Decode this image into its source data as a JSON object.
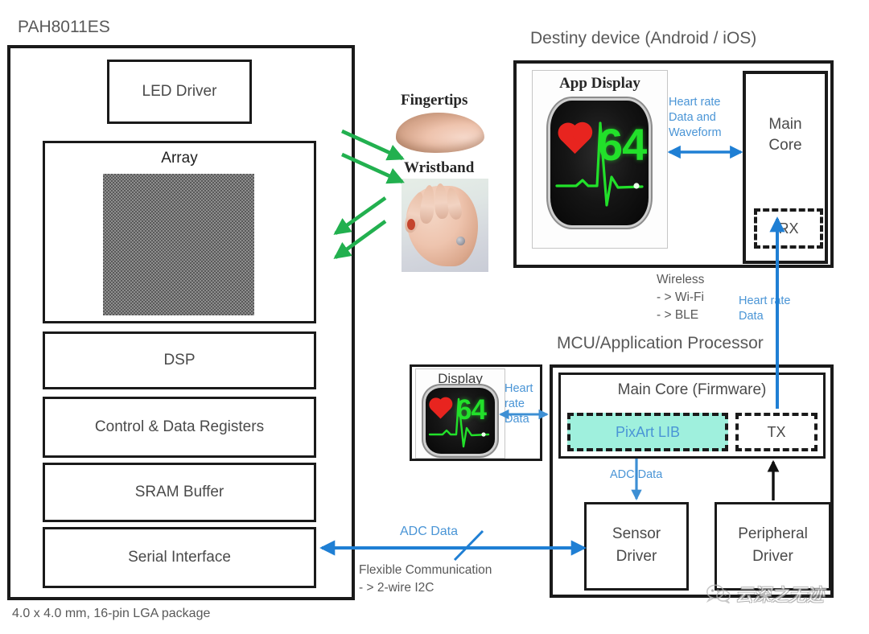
{
  "diagram": {
    "type": "block-diagram",
    "title_left": "PAH8011ES",
    "footnote_left": "4.0 x 4.0 mm, 16-pin LGA package",
    "title_destiny": "Destiny device (Android / iOS)",
    "title_mcu": "MCU/Application Processor"
  },
  "sensor_chip": {
    "label": "PAH8011ES",
    "blocks": [
      {
        "label": "LED Driver"
      },
      {
        "label": "Array"
      },
      {
        "label": "DSP"
      },
      {
        "label": "Control & Data Registers"
      },
      {
        "label": "SRAM Buffer"
      },
      {
        "label": "Serial Interface"
      }
    ],
    "package_note": "4.0 x 4.0 mm, 16-pin LGA package"
  },
  "sensing_targets": [
    {
      "label": "Fingertips",
      "icon": "fingertip-photo"
    },
    {
      "label": "Wristband",
      "icon": "wrist-photo"
    }
  ],
  "destiny_device": {
    "title": "Destiny device (Android / iOS)",
    "display_panel": {
      "label": "App Display",
      "heart_rate": "64",
      "icon": "heart-icon"
    },
    "link_label": "Heart rate\nData and\nWaveform",
    "link_lines": [
      "Heart rate",
      "Data and",
      "Waveform"
    ],
    "main_core": {
      "label_lines": [
        "Main",
        "Core"
      ]
    },
    "rx_block": {
      "label": "RX"
    }
  },
  "wireless": {
    "heading": "Wireless",
    "options": [
      "- > Wi-Fi",
      "- > BLE"
    ],
    "uplink_lines": [
      "Heart rate",
      "Data"
    ]
  },
  "mcu": {
    "title": "MCU/Application Processor",
    "display_panel": {
      "label": "Display",
      "heart_rate": "64",
      "icon": "heart-icon"
    },
    "link_lines": [
      "Heart",
      "rate",
      "Data"
    ],
    "main_core": {
      "label": "Main Core (Firmware)"
    },
    "pixart_lib": {
      "label": "PixArt  LIB"
    },
    "tx_block": {
      "label": "TX"
    },
    "adc_internal_label": "ADC Data",
    "sensor_driver": {
      "label_lines": [
        "Sensor",
        "Driver"
      ]
    },
    "peripheral_driver": {
      "label_lines": [
        "Peripheral",
        "Driver"
      ]
    }
  },
  "bus": {
    "adc_label": "ADC Data",
    "flexible_lines": [
      "Flexible Communication",
      "- > 2-wire I2C"
    ]
  },
  "watermark": {
    "text": "云深之无迹",
    "icon": "wechat-icon"
  },
  "colors": {
    "optical_arrow_green": "#22b04f",
    "data_arrow_blue": "#1f7fd4",
    "blue_text": "#4a95d6",
    "pixart_mint": "#9ff0dd",
    "box_stroke": "#1a1a1a",
    "label_grey": "#595959",
    "heart_red": "#e8241f",
    "hr_green": "#22e02a"
  }
}
